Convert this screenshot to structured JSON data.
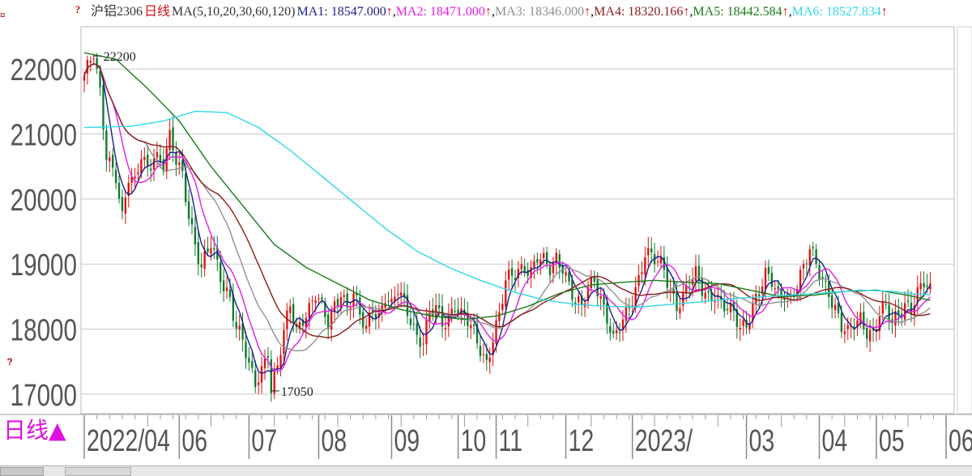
{
  "header": {
    "corner_icon": "¤",
    "settings_icon": "?",
    "symbol": "沪铝2306",
    "period": "日线",
    "ma_params": "MA(5,10,20,30,60,120)",
    "ma_items": [
      {
        "label": "MA1: 18547.000",
        "color": "#1c1c8c"
      },
      {
        "label": "MA2: 18471.000",
        "color": "#e020e0"
      },
      {
        "label": "MA3: 18346.000",
        "color": "#909090"
      },
      {
        "label": "MA4: 18320.166",
        "color": "#8b1a1a"
      },
      {
        "label": "MA5: 18442.584",
        "color": "#1a7a1a"
      },
      {
        "label": "MA6: 18527.834",
        "color": "#30d8e8"
      }
    ],
    "arrow": "↑"
  },
  "left_marker": "?",
  "period_switch": "日线▲",
  "colors": {
    "up": "#e01010",
    "down": "#0a7a2a",
    "grid": "#c8c8c8",
    "axis_text": "#555555"
  },
  "chart_data": {
    "type": "candlestick",
    "y_ticks": [
      17000,
      18000,
      19000,
      20000,
      21000,
      22000
    ],
    "ylim": [
      16700,
      22650
    ],
    "x_labels": [
      {
        "text": "2022/04",
        "day": 0
      },
      {
        "text": "06",
        "day": 30
      },
      {
        "text": "07",
        "day": 52
      },
      {
        "text": "08",
        "day": 74
      },
      {
        "text": "09",
        "day": 97
      },
      {
        "text": "10",
        "day": 118
      },
      {
        "text": "11",
        "day": 130
      },
      {
        "text": "12",
        "day": 152
      },
      {
        "text": "2023/",
        "day": 173
      },
      {
        "text": "03",
        "day": 209
      },
      {
        "text": "04",
        "day": 232
      },
      {
        "text": "05",
        "day": 250
      },
      {
        "text": "06",
        "day": 272
      }
    ],
    "annotations": [
      {
        "text": "22200",
        "value": 22200,
        "day": 3
      },
      {
        "text": "17050",
        "value": 17050,
        "day": 59
      }
    ],
    "close_path": [
      [
        0,
        21900
      ],
      [
        3,
        22200
      ],
      [
        5,
        21600
      ],
      [
        7,
        20700
      ],
      [
        10,
        20400
      ],
      [
        12,
        19700
      ],
      [
        14,
        20300
      ],
      [
        16,
        20200
      ],
      [
        18,
        20700
      ],
      [
        20,
        20500
      ],
      [
        22,
        20700
      ],
      [
        25,
        20500
      ],
      [
        27,
        20900
      ],
      [
        29,
        20600
      ],
      [
        31,
        20400
      ],
      [
        33,
        19800
      ],
      [
        35,
        19300
      ],
      [
        37,
        18900
      ],
      [
        40,
        19300
      ],
      [
        42,
        19000
      ],
      [
        44,
        18700
      ],
      [
        46,
        18500
      ],
      [
        48,
        18000
      ],
      [
        50,
        17800
      ],
      [
        52,
        17400
      ],
      [
        54,
        17200
      ],
      [
        56,
        17400
      ],
      [
        58,
        17700
      ],
      [
        59,
        17050
      ],
      [
        61,
        17400
      ],
      [
        63,
        17900
      ],
      [
        65,
        18400
      ],
      [
        67,
        18000
      ],
      [
        69,
        18200
      ],
      [
        71,
        18300
      ],
      [
        73,
        18500
      ],
      [
        75,
        18300
      ],
      [
        77,
        18100
      ],
      [
        79,
        18400
      ],
      [
        81,
        18600
      ],
      [
        83,
        18300
      ],
      [
        85,
        18500
      ],
      [
        87,
        18200
      ],
      [
        89,
        18000
      ],
      [
        91,
        18400
      ],
      [
        93,
        18200
      ],
      [
        95,
        18500
      ],
      [
        97,
        18300
      ],
      [
        99,
        18600
      ],
      [
        101,
        18400
      ],
      [
        103,
        18200
      ],
      [
        105,
        17900
      ],
      [
        107,
        17800
      ],
      [
        109,
        18200
      ],
      [
        111,
        18300
      ],
      [
        113,
        18100
      ],
      [
        115,
        18200
      ],
      [
        117,
        18400
      ],
      [
        119,
        18200
      ],
      [
        121,
        18100
      ],
      [
        123,
        17900
      ],
      [
        125,
        17700
      ],
      [
        127,
        17500
      ],
      [
        129,
        17900
      ],
      [
        131,
        18200
      ],
      [
        133,
        18700
      ],
      [
        135,
        18800
      ],
      [
        137,
        18900
      ],
      [
        139,
        19000
      ],
      [
        141,
        18900
      ],
      [
        143,
        19100
      ],
      [
        145,
        19000
      ],
      [
        147,
        18900
      ],
      [
        149,
        19100
      ],
      [
        151,
        19000
      ],
      [
        153,
        18700
      ],
      [
        155,
        18400
      ],
      [
        157,
        18300
      ],
      [
        159,
        18600
      ],
      [
        161,
        18800
      ],
      [
        163,
        18500
      ],
      [
        165,
        18200
      ],
      [
        167,
        17800
      ],
      [
        169,
        18000
      ],
      [
        171,
        18200
      ],
      [
        173,
        18500
      ],
      [
        175,
        18800
      ],
      [
        177,
        19200
      ],
      [
        179,
        19100
      ],
      [
        181,
        19000
      ],
      [
        183,
        18900
      ],
      [
        185,
        18600
      ],
      [
        187,
        18400
      ],
      [
        189,
        18500
      ],
      [
        191,
        18700
      ],
      [
        193,
        18800
      ],
      [
        195,
        18600
      ],
      [
        197,
        18500
      ],
      [
        199,
        18600
      ],
      [
        201,
        18400
      ],
      [
        203,
        18300
      ],
      [
        205,
        18200
      ],
      [
        207,
        18000
      ],
      [
        209,
        18100
      ],
      [
        211,
        18400
      ],
      [
        213,
        18600
      ],
      [
        215,
        18800
      ],
      [
        217,
        18700
      ],
      [
        219,
        18500
      ],
      [
        221,
        18600
      ],
      [
        223,
        18500
      ],
      [
        225,
        18700
      ],
      [
        227,
        18900
      ],
      [
        229,
        19200
      ],
      [
        231,
        19000
      ],
      [
        233,
        18800
      ],
      [
        235,
        18600
      ],
      [
        237,
        18300
      ],
      [
        239,
        18000
      ],
      [
        241,
        17900
      ],
      [
        243,
        18100
      ],
      [
        245,
        18200
      ],
      [
        247,
        18000
      ],
      [
        249,
        17900
      ],
      [
        251,
        18200
      ],
      [
        253,
        18300
      ],
      [
        255,
        18100
      ],
      [
        257,
        18300
      ],
      [
        259,
        18400
      ],
      [
        261,
        18300
      ],
      [
        263,
        18500
      ],
      [
        265,
        18700
      ],
      [
        267,
        18600
      ]
    ],
    "ma_lines": [
      {
        "name": "MA1",
        "color": "#1c1c8c",
        "period": 5
      },
      {
        "name": "MA2",
        "color": "#e020e0",
        "period": 10
      },
      {
        "name": "MA3",
        "color": "#909090",
        "period": 20
      },
      {
        "name": "MA4",
        "color": "#8b1a1a",
        "period": 30
      },
      {
        "name": "MA5",
        "color": "#1a7a1a",
        "points": [
          [
            0,
            22250
          ],
          [
            10,
            22150
          ],
          [
            20,
            21700
          ],
          [
            30,
            21200
          ],
          [
            40,
            20500
          ],
          [
            50,
            19900
          ],
          [
            60,
            19300
          ],
          [
            70,
            18950
          ],
          [
            80,
            18700
          ],
          [
            90,
            18450
          ],
          [
            100,
            18300
          ],
          [
            110,
            18200
          ],
          [
            120,
            18150
          ],
          [
            130,
            18200
          ],
          [
            140,
            18350
          ],
          [
            150,
            18550
          ],
          [
            160,
            18680
          ],
          [
            170,
            18720
          ],
          [
            180,
            18750
          ],
          [
            190,
            18720
          ],
          [
            200,
            18700
          ],
          [
            210,
            18600
          ],
          [
            220,
            18500
          ],
          [
            230,
            18520
          ],
          [
            240,
            18580
          ],
          [
            250,
            18600
          ],
          [
            260,
            18520
          ],
          [
            267,
            18442
          ]
        ]
      },
      {
        "name": "MA6",
        "color": "#30d8e8",
        "points": [
          [
            0,
            21100
          ],
          [
            15,
            21120
          ],
          [
            25,
            21200
          ],
          [
            35,
            21350
          ],
          [
            45,
            21330
          ],
          [
            55,
            21100
          ],
          [
            65,
            20750
          ],
          [
            75,
            20350
          ],
          [
            85,
            19950
          ],
          [
            95,
            19550
          ],
          [
            105,
            19200
          ],
          [
            115,
            18950
          ],
          [
            125,
            18750
          ],
          [
            135,
            18580
          ],
          [
            145,
            18450
          ],
          [
            155,
            18380
          ],
          [
            165,
            18350
          ],
          [
            175,
            18340
          ],
          [
            185,
            18380
          ],
          [
            195,
            18420
          ],
          [
            205,
            18470
          ],
          [
            215,
            18500
          ],
          [
            225,
            18530
          ],
          [
            235,
            18560
          ],
          [
            245,
            18600
          ],
          [
            255,
            18580
          ],
          [
            262,
            18540
          ],
          [
            267,
            18528
          ]
        ]
      }
    ]
  }
}
